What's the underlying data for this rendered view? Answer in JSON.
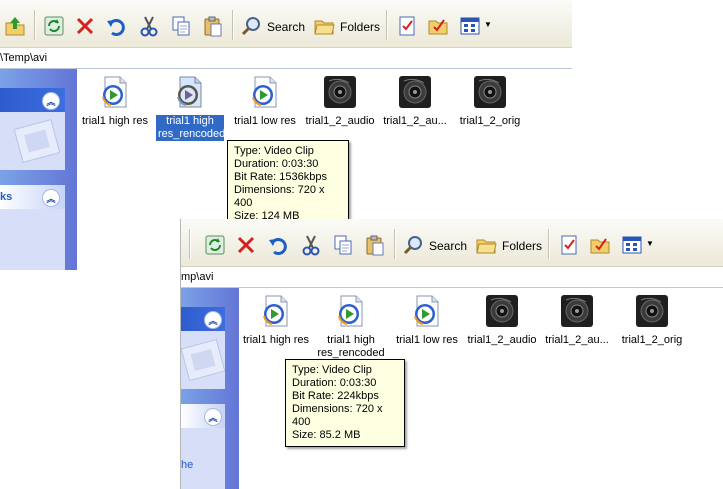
{
  "toolbar": {
    "search_label": "Search",
    "folders_label": "Folders"
  },
  "address": {
    "path": "\\Temp\\avi",
    "path_clipped": "mp\\avi"
  },
  "taskpane": {
    "section_label": "ks",
    "lower_text": "he"
  },
  "files": [
    {
      "label": "trial1 high res",
      "type": "video"
    },
    {
      "label": "trial1 high res_rencoded",
      "type": "video"
    },
    {
      "label": "trial1 low res",
      "type": "video"
    },
    {
      "label": "trial1_2_audio",
      "type": "audio"
    },
    {
      "label": "trial1_2_au...",
      "type": "audio"
    },
    {
      "label": "trial1_2_orig",
      "type": "audio"
    }
  ],
  "tooltip_top": {
    "type": "Type: Video Clip",
    "duration": "Duration: 0:03:30",
    "bitrate": "Bit Rate: 1536kbps",
    "dimensions": "Dimensions: 720 x 400",
    "size": "Size: 124 MB"
  },
  "tooltip_bottom": {
    "type": "Type: Video Clip",
    "duration": "Duration: 0:03:30",
    "bitrate": "Bit Rate: 224kbps",
    "dimensions": "Dimensions: 720 x 400",
    "size": "Size: 85.2 MB"
  },
  "colors": {
    "selection": "#316ac5",
    "taskpane": "#6f8fe0",
    "tooltip": "#ffffe1"
  }
}
